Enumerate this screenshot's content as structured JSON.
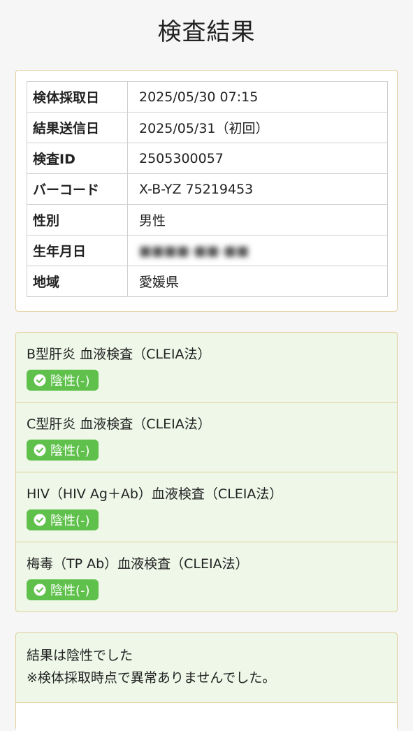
{
  "page": {
    "title": "検査結果"
  },
  "info": {
    "rows": [
      {
        "label": "検体採取日",
        "value": "2025/05/30 07:15"
      },
      {
        "label": "結果送信日",
        "value": "2025/05/31（初回）"
      },
      {
        "label": "検査ID",
        "value": "2505300057"
      },
      {
        "label": "バーコード",
        "value": "X-B-YZ 75219453"
      },
      {
        "label": "性別",
        "value": "男性"
      },
      {
        "label": "生年月日",
        "value": ""
      },
      {
        "label": "地域",
        "value": "愛媛県"
      }
    ]
  },
  "tests": [
    {
      "name": "B型肝炎 血液検査（CLEIA法）",
      "result": "陰性(-)"
    },
    {
      "name": "C型肝炎 血液検査（CLEIA法）",
      "result": "陰性(-)"
    },
    {
      "name": "HIV（HIV Ag＋Ab）血液検査（CLEIA法）",
      "result": "陰性(-)"
    },
    {
      "name": "梅毒（TP Ab）血液検査（CLEIA法）",
      "result": "陰性(-)"
    }
  ],
  "summary": {
    "line1": "結果は陰性でした",
    "line2": "※検体採取時点で異常ありませんでした。"
  },
  "colors": {
    "accent_border": "#e2cf9b",
    "negative_badge": "#5fc14b",
    "result_background": "#eef7e8"
  },
  "icons": {
    "badge_icon": "check-circle-icon"
  }
}
